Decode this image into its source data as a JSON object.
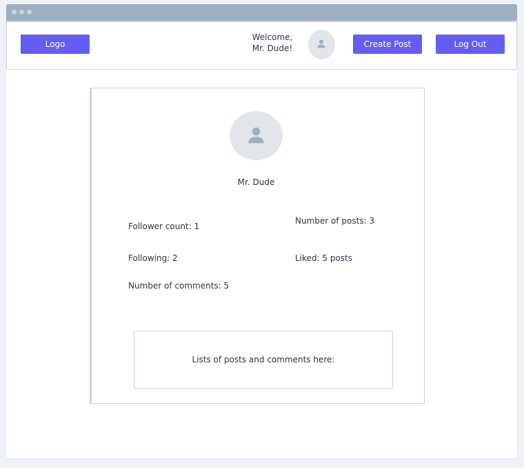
{
  "header": {
    "logo_label": "Logo",
    "welcome_line1": "Welcome,",
    "welcome_line2": "Mr. Dude!",
    "create_post_label": "Create Post",
    "logout_label": "Log Out"
  },
  "profile": {
    "name": "Mr. Dude",
    "follower_count": "Follower count: 1",
    "number_of_posts": "Number of posts: 3",
    "following": "Following: 2",
    "liked": "Liked: 5 posts",
    "number_of_comments": "Number of comments: 5",
    "list_placeholder": "Lists of posts and comments here:"
  },
  "icons": {
    "header_avatar": "user-icon",
    "profile_avatar": "user-icon"
  },
  "colors": {
    "accent": "#655cf6",
    "titlebar": "#9eafbf",
    "avatar_bg": "#e2e6ea",
    "border": "#c9d3dd"
  }
}
